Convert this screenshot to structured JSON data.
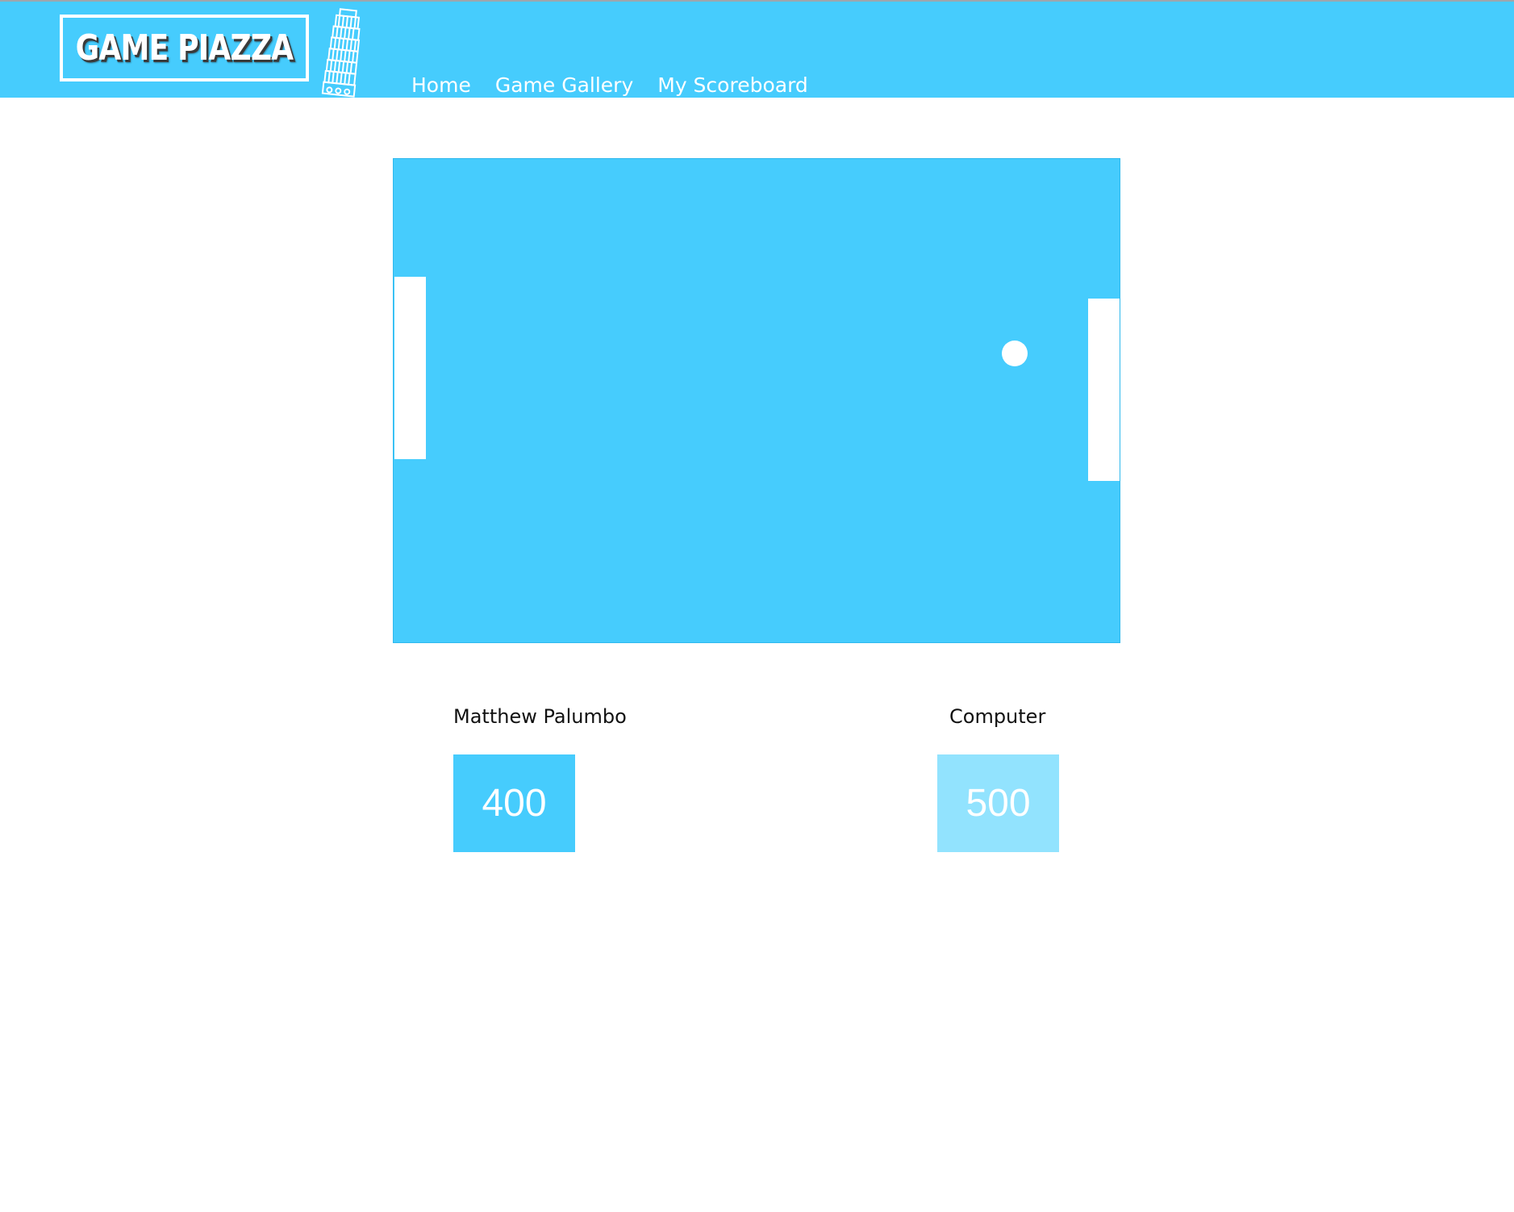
{
  "header": {
    "logo_text": "GAME PIAZZA",
    "logo_icon": "leaning-tower-icon",
    "nav": [
      {
        "label": "Home"
      },
      {
        "label": "Game Gallery"
      },
      {
        "label": "My Scoreboard"
      }
    ]
  },
  "game": {
    "board_color": "#46ccfd",
    "paddle_color": "#ffffff",
    "ball_color": "#ffffff"
  },
  "players": [
    {
      "name": "Matthew Palumbo",
      "score": "400",
      "box_color": "#46ccfd"
    },
    {
      "name": "Computer",
      "score": "500",
      "box_color": "#92e3fe"
    }
  ]
}
